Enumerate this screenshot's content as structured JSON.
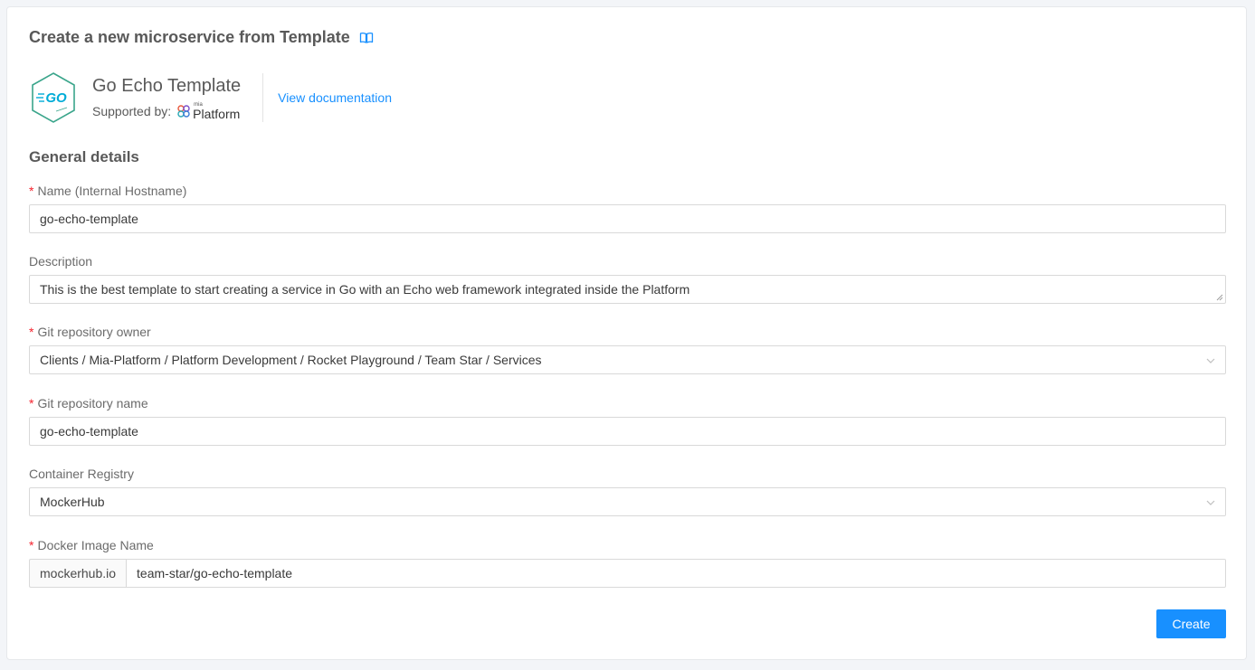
{
  "header": {
    "title": "Create a new microservice from Template",
    "title_icon": "book-icon"
  },
  "template": {
    "name": "Go Echo Template",
    "supported_by_label": "Supported by:",
    "supporter_logo_small": "mia",
    "supporter_logo_name": "Platform",
    "logo_text": "GO",
    "view_documentation": "View documentation"
  },
  "section": {
    "title": "General details"
  },
  "fields": {
    "name": {
      "label": "Name (Internal Hostname)",
      "required": "*",
      "value": "go-echo-template"
    },
    "description": {
      "label": "Description",
      "value": "This is the best template to start creating a service in Go with an Echo web framework integrated inside the Platform"
    },
    "git_owner": {
      "label": "Git repository owner",
      "required": "*",
      "value": "Clients / Mia-Platform / Platform Development / Rocket Playground / Team Star / Services"
    },
    "git_name": {
      "label": "Git repository name",
      "required": "*",
      "value": "go-echo-template"
    },
    "registry": {
      "label": "Container Registry",
      "value": "MockerHub"
    },
    "docker_image": {
      "label": "Docker Image Name",
      "required": "*",
      "addon": "mockerhub.io",
      "value": "team-star/go-echo-template"
    }
  },
  "actions": {
    "create_label": "Create"
  },
  "colors": {
    "primary": "#1890ff",
    "required": "#f5222d",
    "go_logo": "#00acd7",
    "hexagon": "#3aa58b"
  }
}
